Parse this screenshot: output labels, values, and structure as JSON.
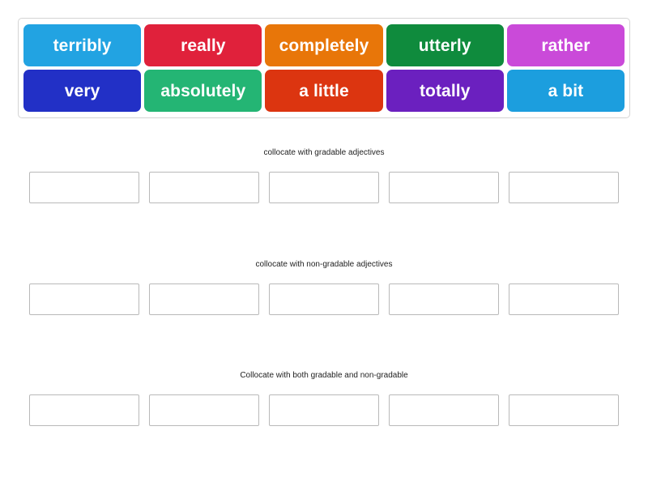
{
  "activity": {
    "type": "group-sort",
    "word_bank": {
      "rows": [
        [
          {
            "label": "terribly",
            "color": "#22a3e2"
          },
          {
            "label": "really",
            "color": "#e0213b"
          },
          {
            "label": "completely",
            "color": "#e87609"
          },
          {
            "label": "utterly",
            "color": "#0f8b3d"
          },
          {
            "label": "rather",
            "color": "#ca4ad9"
          }
        ],
        [
          {
            "label": "very",
            "color": "#2230c6"
          },
          {
            "label": "absolutely",
            "color": "#24b574"
          },
          {
            "label": "a little",
            "color": "#dc3510"
          },
          {
            "label": "totally",
            "color": "#6b20bf"
          },
          {
            "label": "a bit",
            "color": "#1c9ede"
          }
        ]
      ]
    },
    "groups": [
      {
        "title": "collocate with gradable adjectives",
        "slots": [
          "",
          "",
          "",
          "",
          ""
        ]
      },
      {
        "title": "collocate with non-gradable adjectives",
        "slots": [
          "",
          "",
          "",
          "",
          ""
        ]
      },
      {
        "title": "Collocate with both gradable and non-gradable",
        "slots": [
          "",
          "",
          "",
          "",
          ""
        ]
      }
    ]
  }
}
